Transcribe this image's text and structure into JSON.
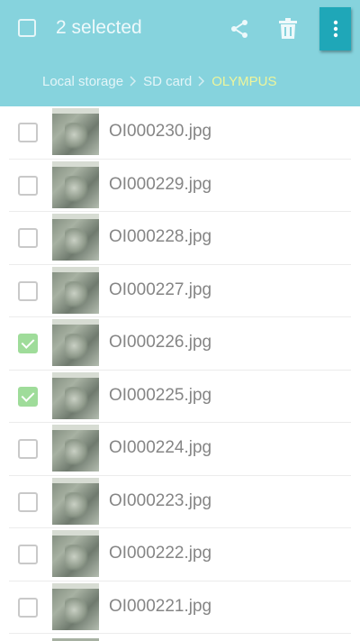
{
  "header": {
    "selected_text": "2 selected",
    "actions": [
      {
        "name": "share-icon"
      },
      {
        "name": "trash-icon"
      },
      {
        "name": "more-vert-icon"
      }
    ],
    "breadcrumb": [
      "Local storage",
      "SD card",
      "OLYMPUS"
    ],
    "colors": {
      "bar": "#86d3dd",
      "active_button": "#1fa7b8",
      "current_crumb": "#eef59b"
    }
  },
  "files": [
    {
      "name": "OI000230.jpg",
      "checked": false
    },
    {
      "name": "OI000229.jpg",
      "checked": false
    },
    {
      "name": "OI000228.jpg",
      "checked": false
    },
    {
      "name": "OI000227.jpg",
      "checked": false
    },
    {
      "name": "OI000226.jpg",
      "checked": true
    },
    {
      "name": "OI000225.jpg",
      "checked": true
    },
    {
      "name": "OI000224.jpg",
      "checked": false
    },
    {
      "name": "OI000223.jpg",
      "checked": false
    },
    {
      "name": "OI000222.jpg",
      "checked": false
    },
    {
      "name": "OI000221.jpg",
      "checked": false
    }
  ]
}
